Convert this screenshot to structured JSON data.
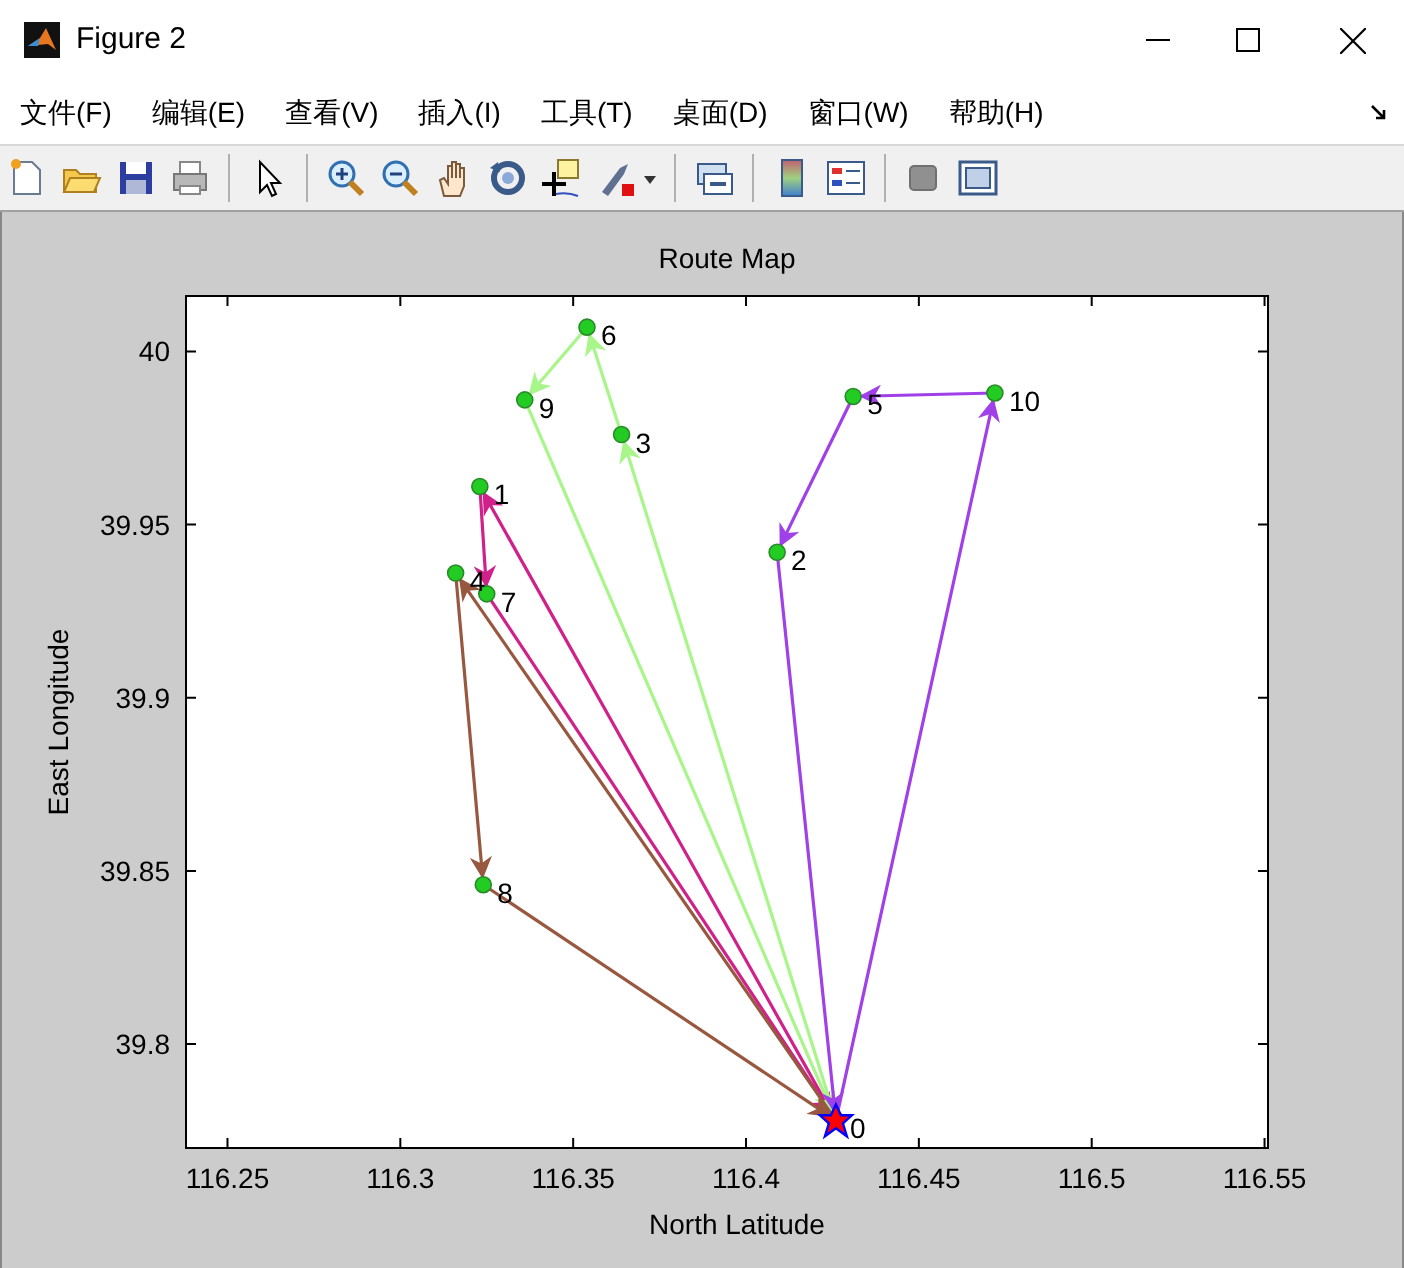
{
  "window": {
    "title": "Figure 2"
  },
  "menu": [
    "文件(F)",
    "编辑(E)",
    "查看(V)",
    "插入(I)",
    "工具(T)",
    "桌面(D)",
    "窗口(W)",
    "帮助(H)"
  ],
  "toolbar": [
    {
      "kind": "new"
    },
    {
      "kind": "open"
    },
    {
      "kind": "save"
    },
    {
      "kind": "print"
    },
    {
      "kind": "sep"
    },
    {
      "kind": "pointer"
    },
    {
      "kind": "sep"
    },
    {
      "kind": "zoom_in"
    },
    {
      "kind": "zoom_out"
    },
    {
      "kind": "pan"
    },
    {
      "kind": "rotate"
    },
    {
      "kind": "cursor"
    },
    {
      "kind": "brush"
    },
    {
      "kind": "sep"
    },
    {
      "kind": "link"
    },
    {
      "kind": "sep"
    },
    {
      "kind": "colorbar"
    },
    {
      "kind": "legend"
    },
    {
      "kind": "sep"
    },
    {
      "kind": "hide"
    },
    {
      "kind": "show"
    }
  ],
  "chart_data": {
    "type": "line",
    "title": "Route Map",
    "xlabel": "North Latitude",
    "ylabel": "East Longitude",
    "xlim": [
      116.238,
      116.551
    ],
    "ylim": [
      39.77,
      40.016
    ],
    "xticks": [
      {
        "value": 116.25,
        "label": "116.25"
      },
      {
        "value": 116.3,
        "label": "116.3"
      },
      {
        "value": 116.35,
        "label": "116.35"
      },
      {
        "value": 116.4,
        "label": "116.4"
      },
      {
        "value": 116.45,
        "label": "116.45"
      },
      {
        "value": 116.5,
        "label": "116.5"
      },
      {
        "value": 116.55,
        "label": "116.55"
      }
    ],
    "yticks": [
      {
        "value": 39.8,
        "label": "39.8"
      },
      {
        "value": 39.85,
        "label": "39.85"
      },
      {
        "value": 39.9,
        "label": "39.9"
      },
      {
        "value": 39.95,
        "label": "39.95"
      },
      {
        "value": 40,
        "label": "40"
      }
    ],
    "series": [
      {
        "color": "#d0208a",
        "marker": "circle",
        "x": [
          116.426,
          116.323,
          116.325,
          116.426
        ],
        "values": [
          39.778,
          39.961,
          39.93,
          39.778
        ]
      },
      {
        "color": "#a8f58a",
        "marker": "circle",
        "x": [
          116.426,
          116.364,
          116.354,
          116.336,
          116.426
        ],
        "values": [
          39.778,
          39.976,
          40.007,
          39.986,
          39.778
        ]
      },
      {
        "color": "#a040e8",
        "marker": "circle",
        "x": [
          116.426,
          116.472,
          116.431,
          116.409,
          116.426
        ],
        "values": [
          39.778,
          39.988,
          39.987,
          39.942,
          39.778
        ]
      },
      {
        "color": "#985840",
        "marker": "circle",
        "x": [
          116.426,
          116.316,
          116.324,
          116.426
        ],
        "values": [
          39.778,
          39.936,
          39.846,
          39.778
        ]
      },
      {
        "color": "#ff0000",
        "marker": "star",
        "x": [
          116.426
        ],
        "values": [
          39.778
        ]
      }
    ],
    "annotations": [
      {
        "text": "0",
        "x": 116.426,
        "y": 39.778
      },
      {
        "text": "1",
        "x": 116.323,
        "y": 39.961
      },
      {
        "text": "2",
        "x": 116.409,
        "y": 39.942
      },
      {
        "text": "3",
        "x": 116.364,
        "y": 39.976
      },
      {
        "text": "4",
        "x": 116.316,
        "y": 39.936
      },
      {
        "text": "5",
        "x": 116.431,
        "y": 39.987
      },
      {
        "text": "6",
        "x": 116.354,
        "y": 40.007
      },
      {
        "text": "7",
        "x": 116.325,
        "y": 39.93
      },
      {
        "text": "8",
        "x": 116.324,
        "y": 39.846
      },
      {
        "text": "9",
        "x": 116.336,
        "y": 39.986
      },
      {
        "text": "10",
        "x": 116.472,
        "y": 39.988
      }
    ]
  }
}
